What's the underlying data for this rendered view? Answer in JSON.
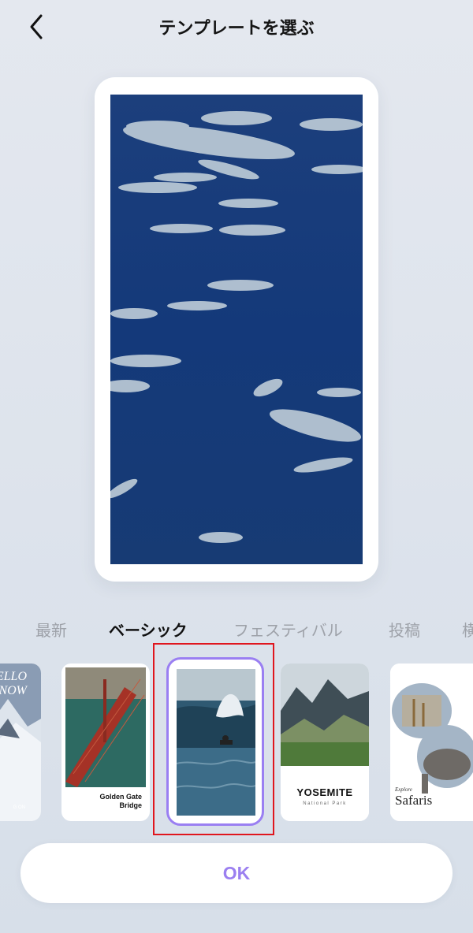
{
  "header": {
    "title": "テンプレートを選ぶ",
    "back_icon": "chevron-left-icon"
  },
  "preview": {
    "image": "underwater fish school video preview"
  },
  "tabs": [
    {
      "label": "最新",
      "active": false
    },
    {
      "label": "ベーシック",
      "active": true
    },
    {
      "label": "フェスティバル",
      "active": false
    },
    {
      "label": "投稿",
      "active": false
    },
    {
      "label": "横",
      "active": false
    }
  ],
  "templates": [
    {
      "name": "hello-snow",
      "text": "ELLO\nNOW",
      "footer": "G ON"
    },
    {
      "name": "golden-gate",
      "text": "Golden Gate\nBridge"
    },
    {
      "name": "surf",
      "selected": true
    },
    {
      "name": "yosemite",
      "text": "YOSEMITE",
      "subtext": "National Park"
    },
    {
      "name": "safaris",
      "text_small": "Explore",
      "text": "Safaris"
    }
  ],
  "ok_button": {
    "label": "OK"
  },
  "colors": {
    "accent": "#9b7ff0",
    "selection_outline": "#e0161e"
  }
}
